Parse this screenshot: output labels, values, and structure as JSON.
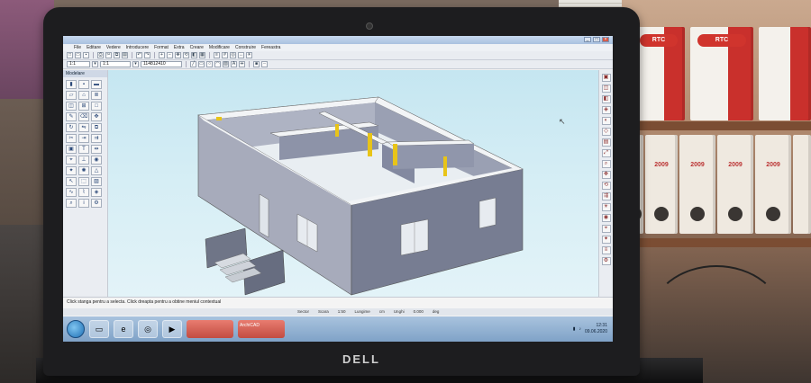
{
  "screen": {
    "app_title": "",
    "menu": [
      "File",
      "Editare",
      "Vedere",
      "Introducere",
      "Format",
      "Extra",
      "Creare",
      "Modificare",
      "Construire",
      "Fereastra"
    ],
    "toolbar_value": "1:1",
    "toolbar_scale": "1:1",
    "coordinate_box": "114812410",
    "toolbox_title": "Modelare",
    "prompt_text": "Click stanga pentru a selecta. Click dreapta pentru a obtine meniul contextual",
    "status_items": [
      "Sector",
      "Scara",
      "1:50",
      "Lungime",
      "cm",
      "Unghi",
      "0.000",
      "deg"
    ],
    "taskbar_windows": [
      "",
      "ArchiCAD"
    ],
    "clock_time": "12:31",
    "clock_date": "09.06.2020"
  },
  "laptop": {
    "brand": "DELL"
  },
  "shelf": {
    "binder_labels": [
      "RTC",
      "RTC"
    ],
    "binder_years": [
      "2009",
      "2009",
      "2009",
      "2009",
      "2009"
    ]
  }
}
